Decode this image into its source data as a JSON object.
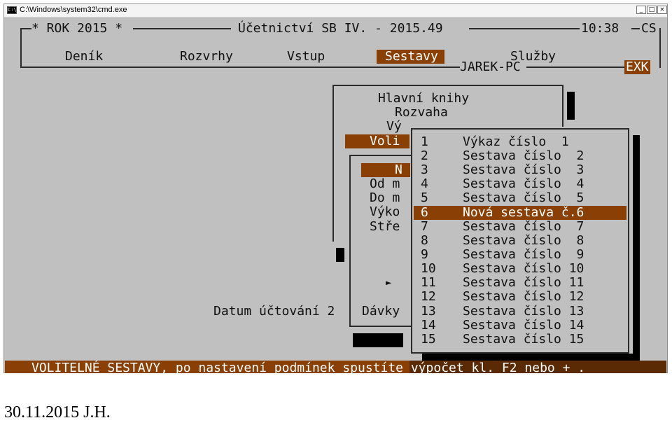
{
  "window": {
    "title": "C:\\Windows\\system32\\cmd.exe",
    "icon_label": "C:\\",
    "buttons": [
      "_",
      "□",
      "×"
    ]
  },
  "header": {
    "left": "* ROK 2015 *",
    "center": "Účetnictví SB IV. - 2015.49",
    "time": "10:38",
    "code": "CS",
    "computer": "JAREK-PC",
    "exk": "EXK"
  },
  "menu": {
    "items": [
      {
        "label": "Deník"
      },
      {
        "label": "Rozvrhy"
      },
      {
        "label": "Vstup"
      },
      {
        "label": "Sestavy",
        "active": true
      },
      {
        "label": "Služby"
      }
    ]
  },
  "sestavy_menu": {
    "items": [
      "Hlavní knihy",
      "Rozvaha",
      "Vý",
      "Voli"
    ]
  },
  "volitelne_panel": {
    "selected_label": "N",
    "lines": [
      "Od m",
      "Do m",
      "Výko",
      "Stře"
    ],
    "arrow": "►"
  },
  "datum_label": "Datum účtování 2",
  "davky_label": "Dávky",
  "popup": {
    "items": [
      {
        "num": "1",
        "label": "Výkaz číslo  1"
      },
      {
        "num": "2",
        "label": "Sestava číslo  2"
      },
      {
        "num": "3",
        "label": "Sestava číslo  3"
      },
      {
        "num": "4",
        "label": "Sestava číslo  4"
      },
      {
        "num": "5",
        "label": "Sestava číslo  5"
      },
      {
        "num": "6",
        "label": "Nová sestava č.6",
        "selected": true
      },
      {
        "num": "7",
        "label": "Sestava číslo  7"
      },
      {
        "num": "8",
        "label": "Sestava číslo  8"
      },
      {
        "num": "9",
        "label": "Sestava číslo  9"
      },
      {
        "num": "10",
        "label": "Sestava číslo 10"
      },
      {
        "num": "11",
        "label": "Sestava číslo 11"
      },
      {
        "num": "12",
        "label": "Sestava číslo 12"
      },
      {
        "num": "13",
        "label": "Sestava číslo 13"
      },
      {
        "num": "14",
        "label": "Sestava číslo 14"
      },
      {
        "num": "15",
        "label": "Sestava číslo 15"
      }
    ]
  },
  "status_bar": "VOLITELNÉ SESTAVY, po nastavení podmínek spustíte výpočet kl. F2 nebo + .",
  "footer": "30.11.2015 J.H.",
  "colors": {
    "highlight": "#8a3f05",
    "console_bg": "#c0c0c0",
    "text": "#111111"
  }
}
